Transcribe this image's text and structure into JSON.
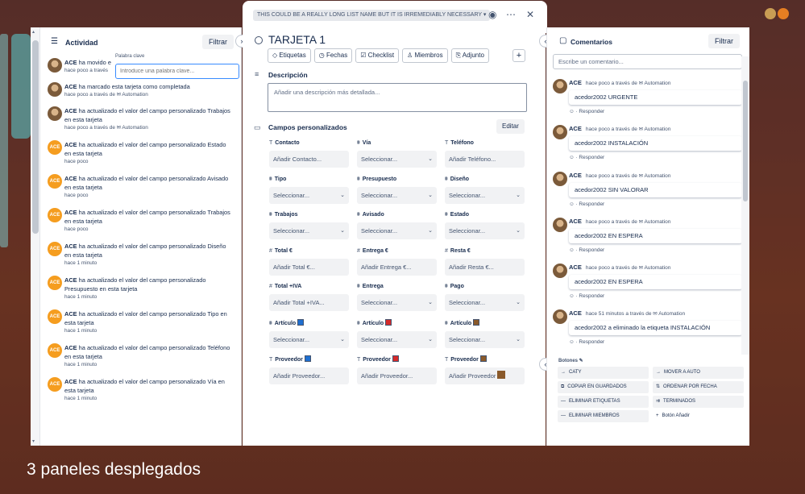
{
  "list_name": "THIS COULD BE A REALLY LONG LIST NAME BUT IT IS IRREMEDIABLY NECESSARY",
  "activity": {
    "title": "Actividad",
    "filter_label": "Filtrar",
    "keyword_label": "Palabra clave",
    "keyword_placeholder": "Introduce una palabra clave...",
    "items": [
      {
        "user": "ACE",
        "text": "ha movido e",
        "meta": "hace poco a través",
        "avatar": "photo"
      },
      {
        "user": "ACE",
        "text": "ha marcado esta tarjeta como completada",
        "meta": "hace poco a través de ✉ Automation",
        "avatar": "photo"
      },
      {
        "user": "ACE",
        "text": "ha actualizado el valor del campo personalizado Trabajos en esta tarjeta",
        "meta": "hace poco a través de ✉ Automation",
        "avatar": "photo"
      },
      {
        "user": "ACE",
        "text": "ha actualizado el valor del campo personalizado Estado en esta tarjeta",
        "meta": "hace poco",
        "avatar": "ace"
      },
      {
        "user": "ACE",
        "text": "ha actualizado el valor del campo personalizado Avisado en esta tarjeta",
        "meta": "hace poco",
        "avatar": "ace"
      },
      {
        "user": "ACE",
        "text": "ha actualizado el valor del campo personalizado Trabajos en esta tarjeta",
        "meta": "hace poco",
        "avatar": "ace"
      },
      {
        "user": "ACE",
        "text": "ha actualizado el valor del campo personalizado Diseño en esta tarjeta",
        "meta": "hace 1 minuto",
        "avatar": "ace"
      },
      {
        "user": "ACE",
        "text": "ha actualizado el valor del campo personalizado Presupuesto en esta tarjeta",
        "meta": "hace 1 minuto",
        "avatar": "ace"
      },
      {
        "user": "ACE",
        "text": "ha actualizado el valor del campo personalizado Tipo en esta tarjeta",
        "meta": "hace 1 minuto",
        "avatar": "ace"
      },
      {
        "user": "ACE",
        "text": "ha actualizado el valor del campo personalizado Teléfono en esta tarjeta",
        "meta": "hace 1 minuto",
        "avatar": "ace"
      },
      {
        "user": "ACE",
        "text": "ha actualizado el valor del campo personalizado Vía en esta tarjeta",
        "meta": "hace 1 minuto",
        "avatar": "ace"
      }
    ]
  },
  "card": {
    "title": "TARJETA 1",
    "actions": [
      "Etiquetas",
      "Fechas",
      "Checklist",
      "Miembros",
      "Adjunto"
    ],
    "action_icons": [
      "◇",
      "◷",
      "☑",
      "♙",
      "⎘"
    ],
    "plus": "+",
    "description_title": "Descripción",
    "description_placeholder": "Añadir una descripción más detallada...",
    "custom_fields_title": "Campos personalizados",
    "edit_label": "Editar",
    "fields": [
      {
        "label": "Contacto",
        "icon": "T",
        "value": "Añadir Contacto...",
        "dropdown": false
      },
      {
        "label": "Vía",
        "icon": "⩩",
        "value": "Seleccionar...",
        "dropdown": true
      },
      {
        "label": "Teléfono",
        "icon": "T",
        "value": "Añadir Teléfono...",
        "dropdown": false
      },
      {
        "label": "Tipo",
        "icon": "⩩",
        "value": "Seleccionar...",
        "dropdown": true
      },
      {
        "label": "Presupuesto",
        "icon": "⩩",
        "value": "Seleccionar...",
        "dropdown": true
      },
      {
        "label": "Diseño",
        "icon": "⩩",
        "value": "Seleccionar...",
        "dropdown": true
      },
      {
        "label": "Trabajos",
        "icon": "⩩",
        "value": "Seleccionar...",
        "dropdown": true
      },
      {
        "label": "Avisado",
        "icon": "⩩",
        "value": "Seleccionar...",
        "dropdown": true
      },
      {
        "label": "Estado",
        "icon": "⩩",
        "value": "Seleccionar...",
        "dropdown": true
      },
      {
        "label": "Total €",
        "icon": "#",
        "value": "Añadir Total €...",
        "dropdown": false
      },
      {
        "label": "Entrega €",
        "icon": "#",
        "value": "Añadir Entrega €...",
        "dropdown": false
      },
      {
        "label": "Resta €",
        "icon": "#",
        "value": "Añadir Resta €...",
        "dropdown": false
      },
      {
        "label": "Total +IVA",
        "icon": "#",
        "value": "Añadir Total +IVA...",
        "dropdown": false
      },
      {
        "label": "Entrega",
        "icon": "⩩",
        "value": "Seleccionar...",
        "dropdown": true
      },
      {
        "label": "Pago",
        "icon": "⩩",
        "value": "Seleccionar...",
        "dropdown": true
      },
      {
        "label": "Artículo",
        "icon": "⩩",
        "value": "Seleccionar...",
        "dropdown": true,
        "swatch": "#1f6fd0"
      },
      {
        "label": "Artículo",
        "icon": "⩩",
        "value": "Seleccionar...",
        "dropdown": true,
        "swatch": "#d62a2a"
      },
      {
        "label": "Artículo",
        "icon": "⩩",
        "value": "Seleccionar...",
        "dropdown": true,
        "swatch": "#8a5a2b"
      },
      {
        "label": "Proveedor",
        "icon": "T",
        "value": "Añadir Proveedor...",
        "dropdown": false,
        "swatch": "#1f6fd0"
      },
      {
        "label": "Proveedor",
        "icon": "T",
        "value": "Añadir Proveedor...",
        "dropdown": false,
        "swatch": "#d62a2a"
      },
      {
        "label": "Proveedor",
        "icon": "T",
        "value": "Añadir Proveedor",
        "dropdown": false,
        "swatch": "#8a5a2b"
      }
    ]
  },
  "comments": {
    "title": "Comentarios",
    "filter_label": "Filtrar",
    "input_placeholder": "Escribe un comentario...",
    "reply_label": "Responder",
    "items": [
      {
        "user": "ACE",
        "meta": "hace poco a través de ✉ Automation",
        "body": "acedor2002 URGENTE"
      },
      {
        "user": "ACE",
        "meta": "hace poco a través de ✉ Automation",
        "body": "acedor2002 INSTALACIÓN"
      },
      {
        "user": "ACE",
        "meta": "hace poco a través de ✉ Automation",
        "body": "acedor2002 SIN VALORAR"
      },
      {
        "user": "ACE",
        "meta": "hace poco a través de ✉ Automation",
        "body": "acedor2002 EN ESPERA"
      },
      {
        "user": "ACE",
        "meta": "hace poco a través de ✉ Automation",
        "body": "acedor2002 EN ESPERA"
      },
      {
        "user": "ACE",
        "meta": "hace 51 minutos a través de ✉ Automation",
        "body": "acedor2002 a eliminado la etiqueta INSTALACIÓN"
      }
    ],
    "buttons_title": "Botones ✎",
    "buttons": [
      {
        "label": "CATY",
        "icon": "→"
      },
      {
        "label": "MOVER A AUTO",
        "icon": "→"
      },
      {
        "label": "COPIAR EN GUARDADOS",
        "icon": "⧉"
      },
      {
        "label": "ORDENAR POR FECHA",
        "icon": "⇅"
      },
      {
        "label": "ELIMINAR ETIQUETAS",
        "icon": "—"
      },
      {
        "label": "TERMINADOS",
        "icon": "⇉"
      },
      {
        "label": "ELIMINAR MIEMBROS",
        "icon": "—"
      },
      {
        "label": "Botón Añadir",
        "icon": "+"
      }
    ]
  },
  "caption": "3 paneles desplegados"
}
